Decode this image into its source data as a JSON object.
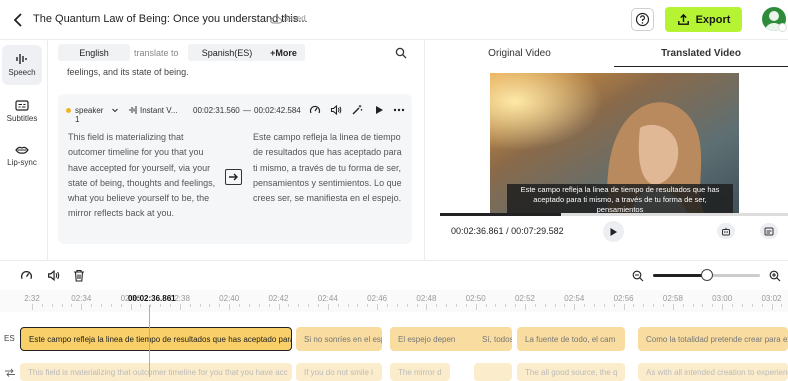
{
  "header": {
    "title": "The Quantum Law of Being: Once you understand this...",
    "save_status": "Saved",
    "export_label": "Export"
  },
  "rail": [
    {
      "label": "Speech",
      "icon": "speech-wave-icon"
    },
    {
      "label": "Subtitles",
      "icon": "subtitles-icon"
    },
    {
      "label": "Lip-sync",
      "icon": "lip-sync-icon"
    }
  ],
  "lang": {
    "source": "English",
    "translate_to": "translate to",
    "target": "Spanish(ES)",
    "more": "+More"
  },
  "prev_text": "feelings, and its state of being.",
  "segment": {
    "speaker": "speaker 1",
    "voice": "Instant V...",
    "start": "00:02:31.560",
    "dash": "—",
    "end": "00:02:42.584",
    "source_text": "This field is materializing that outcomer timeline for you that you have accepted for yourself, via your state of being, thoughts and feelings, what you believe yourself to be, the mirror reflects back at you.",
    "translated_text": "Este campo refleja la linea de tiempo de resultados que has aceptado para ti mismo, a través de tu forma de ser, pensamientos y sentimientos. Lo que crees ser, se manifiesta en el espejo."
  },
  "video": {
    "tab_original": "Original Video",
    "tab_translated": "Translated Video",
    "subtitle": "Este campo refleja la linea de tiempo de resultados que has aceptado para ti mismo, a través de tu forma de ser, pensamientos",
    "current_time": "00:02:36.861",
    "total_time": "00:07:29.582",
    "time_sep": " / ",
    "progress": 0.347
  },
  "zoom_level": 0.46,
  "timeline": {
    "playhead_label": "00:02:36.861",
    "ticks": [
      "2:32",
      "02:34",
      "02:36",
      "02:38",
      "02:40",
      "02:42",
      "02:44",
      "02:46",
      "02:48",
      "02:50",
      "02:52",
      "02:54",
      "02:56",
      "02:58",
      "03:00",
      "03:02"
    ],
    "track_label": "ES",
    "segments_es": [
      "Este campo refleja la linea de tiempo de resultados que has aceptado para ti",
      "Si no sonríes en el esp",
      "El espejo depen",
      "Sí, todos los",
      "La fuente de todo, el cam",
      "Como la totalidad pretende crear para ex"
    ],
    "segments_en": [
      "This field is materializing that outcomer timeline for you that you have acc",
      "If you do not smile i",
      "The mirror d",
      "",
      "The all good source, the q",
      "As with all intended creation to experience"
    ]
  },
  "colors": {
    "accent": "#b6f332",
    "segment": "#f8dca0",
    "segment_selected": "#f8cf69",
    "playhead": "#9bd11f"
  }
}
